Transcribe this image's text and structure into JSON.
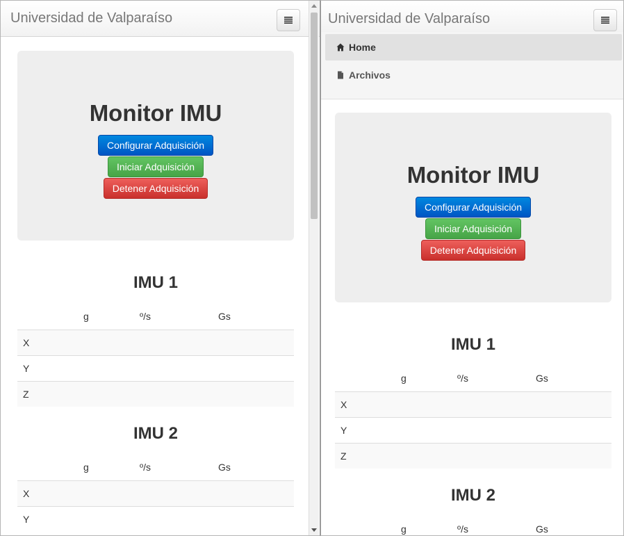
{
  "brand": "Universidad de Valparaíso",
  "nav": {
    "items": [
      {
        "label": "Home",
        "icon": "home-icon",
        "active": true
      },
      {
        "label": "Archivos",
        "icon": "file-icon",
        "active": false
      }
    ]
  },
  "hero": {
    "title": "Monitor IMU",
    "buttons": {
      "configure": "Configurar Adquisición",
      "start": "Iniciar Adquisición",
      "stop": "Detener Adquisición"
    }
  },
  "imu_sections": [
    {
      "title": "IMU 1",
      "columns": [
        "",
        "g",
        "º/s",
        "Gs"
      ],
      "rows": [
        "X",
        "Y",
        "Z"
      ]
    },
    {
      "title": "IMU 2",
      "columns": [
        "",
        "g",
        "º/s",
        "Gs"
      ],
      "rows": [
        "X",
        "Y"
      ]
    }
  ],
  "colors": {
    "primary": "#0066cc",
    "success": "#5cb85c",
    "danger": "#d9534f",
    "jumbotron": "#eeeeee"
  }
}
